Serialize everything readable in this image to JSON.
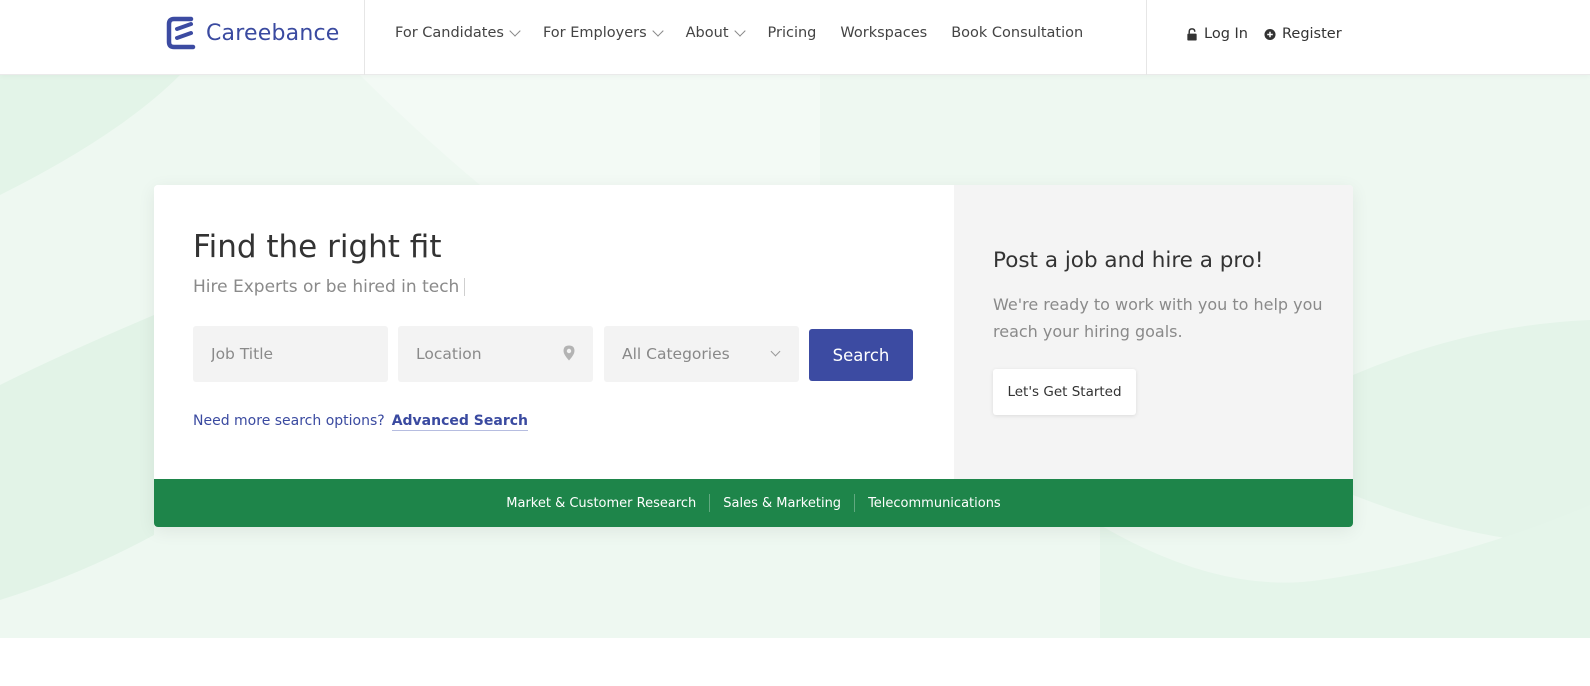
{
  "brand": {
    "name": "Careebance",
    "color": "#3c4ba2"
  },
  "nav": {
    "items": [
      {
        "label": "For Candidates",
        "dropdown": true
      },
      {
        "label": "For Employers",
        "dropdown": true
      },
      {
        "label": "About",
        "dropdown": true
      },
      {
        "label": "Pricing",
        "dropdown": false
      },
      {
        "label": "Workspaces",
        "dropdown": false
      },
      {
        "label": "Book Consultation",
        "dropdown": false
      }
    ]
  },
  "auth": {
    "login": "Log In",
    "register": "Register"
  },
  "hero": {
    "title": "Find the right fit",
    "subtitle": "Hire Experts or be hired in tech",
    "job_title_placeholder": "Job Title",
    "location_placeholder": "Location",
    "category_selected": "All Categories",
    "search_label": "Search",
    "more_options_text": "Need more search options?",
    "advanced_search_label": "Advanced Search"
  },
  "post_job": {
    "title": "Post a job and hire a pro!",
    "description": "We're ready to work with you to help you reach your hiring goals.",
    "cta_label": "Let's Get Started"
  },
  "categories": [
    "Market & Customer Research",
    "Sales & Marketing",
    "Telecommunications"
  ],
  "colors": {
    "accent": "#3c4ba2",
    "green": "#1e854a",
    "hero_bg": "#eef8f1"
  }
}
